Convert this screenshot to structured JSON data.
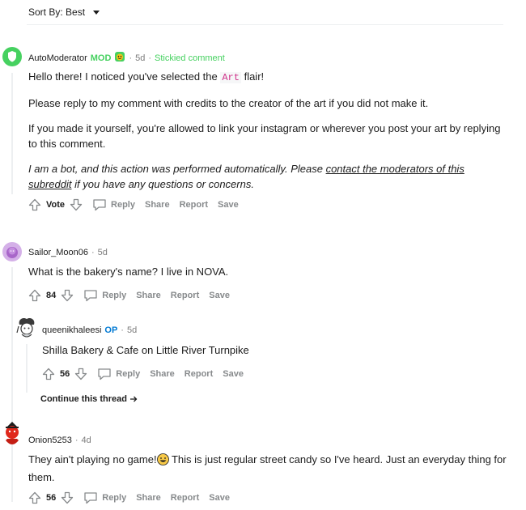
{
  "sort": {
    "label": "Sort By: Best"
  },
  "comments": [
    {
      "username": "AutoModerator",
      "mod_label": "MOD",
      "time": "5d",
      "stickied": "Stickied comment",
      "paragraphs": {
        "p1_before": "Hello there! I noticed you've selected the ",
        "p1_flair": "Art",
        "p1_after": " flair!",
        "p2": "Please reply to my comment with credits to the creator of the art if you did not make it.",
        "p3": "If you made it yourself, you're allowed to link your instagram or wherever you post your art by replying to this comment.",
        "p4_before": "I am a bot, and this action was performed automatically. Please ",
        "p4_link": "contact the moderators of this subreddit",
        "p4_after": " if you have any questions or concerns."
      },
      "vote_label": "Vote"
    },
    {
      "username": "Sailor_Moon06",
      "time": "5d",
      "text": "What is the bakery's name? I live in NOVA.",
      "votes": "84"
    },
    {
      "username": "queenikhaleesi",
      "op_label": "OP",
      "time": "5d",
      "text": "Shilla Bakery & Cafe on Little River Turnpike",
      "votes": "56"
    },
    {
      "username": "Onion5253",
      "time": "4d",
      "text_before": "They ain't playing no game!",
      "text_after": " This is just regular street candy so I've heard. Just an everyday thing for them.",
      "votes": "56"
    }
  ],
  "actions": {
    "reply": "Reply",
    "share": "Share",
    "report": "Report",
    "save": "Save"
  },
  "continue_thread": "Continue this thread",
  "colors": {
    "mod_green": "#46d160",
    "op_blue": "#0079d3",
    "meta_gray": "#7c7c7c",
    "action_gray": "#878a8c"
  }
}
